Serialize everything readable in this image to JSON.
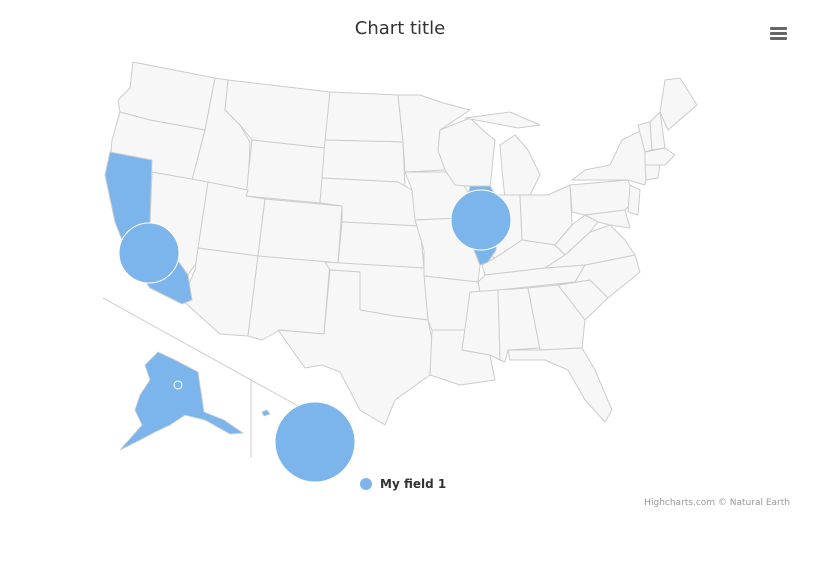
{
  "chart": {
    "title": "Chart title",
    "menu_icon": "hamburger-menu-icon",
    "credits": "Highcharts.com © Natural Earth"
  },
  "colors": {
    "land": "#f7f7f7",
    "border": "#cccccc",
    "highlight": "#7cb5ec",
    "inset_line": "#cccccc"
  },
  "chart_data": {
    "type": "map",
    "map": "us-all",
    "highlighted_states": [
      "California",
      "Illinois",
      "Alaska"
    ],
    "series": [
      {
        "name": "My field 1",
        "type": "mapbubble",
        "points": [
          {
            "state": "California",
            "size": "medium"
          },
          {
            "state": "Illinois",
            "size": "medium"
          },
          {
            "state": "Alaska",
            "size": "small"
          },
          {
            "state": "Hawaii",
            "size": "large"
          }
        ]
      }
    ],
    "legend": {
      "position": "bottom-center",
      "items": [
        "My field 1"
      ]
    }
  }
}
